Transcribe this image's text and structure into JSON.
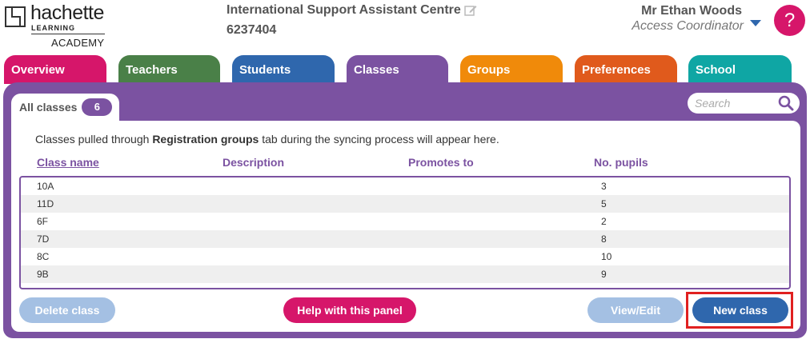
{
  "logo": {
    "name": "hachette",
    "sub": "LEARNING",
    "academy": "ACADEMY"
  },
  "header": {
    "centre_name": "International Support Assistant Centre",
    "centre_id": "6237404",
    "user_name": "Mr Ethan Woods",
    "user_role": "Access Coordinator",
    "help_symbol": "?"
  },
  "tabs": [
    {
      "label": "Overview",
      "color": "#d6166a"
    },
    {
      "label": "Teachers",
      "color": "#4a8048"
    },
    {
      "label": "Students",
      "color": "#2f67ad"
    },
    {
      "label": "Classes",
      "color": "#7b52a1",
      "active": true
    },
    {
      "label": "Groups",
      "color": "#f08a0a"
    },
    {
      "label": "Preferences",
      "color": "#e05a1c"
    },
    {
      "label": "School",
      "color": "#0fa6a4"
    }
  ],
  "subtab": {
    "label": "All classes",
    "count": "6"
  },
  "search": {
    "placeholder": "Search"
  },
  "info": {
    "before": "Classes pulled through ",
    "bold": "Registration groups",
    "after": " tab during the syncing process will appear here."
  },
  "table": {
    "headers": {
      "class_name": "Class name",
      "description": "Description",
      "promotes_to": "Promotes to",
      "pupils": "No. pupils"
    },
    "rows": [
      {
        "name": "10A",
        "pupils": "3"
      },
      {
        "name": "11D",
        "pupils": "5"
      },
      {
        "name": "6F",
        "pupils": "2"
      },
      {
        "name": "7D",
        "pupils": "8"
      },
      {
        "name": "8C",
        "pupils": "10"
      },
      {
        "name": "9B",
        "pupils": "9"
      }
    ]
  },
  "buttons": {
    "delete": "Delete class",
    "help": "Help with this panel",
    "view_edit": "View/Edit",
    "new_class": "New class"
  },
  "colors": {
    "accent": "#7b52a1",
    "primary_button": "#2f67ad",
    "disabled_button": "#a4c0e3",
    "help": "#d6166a",
    "highlight": "#e02020"
  }
}
